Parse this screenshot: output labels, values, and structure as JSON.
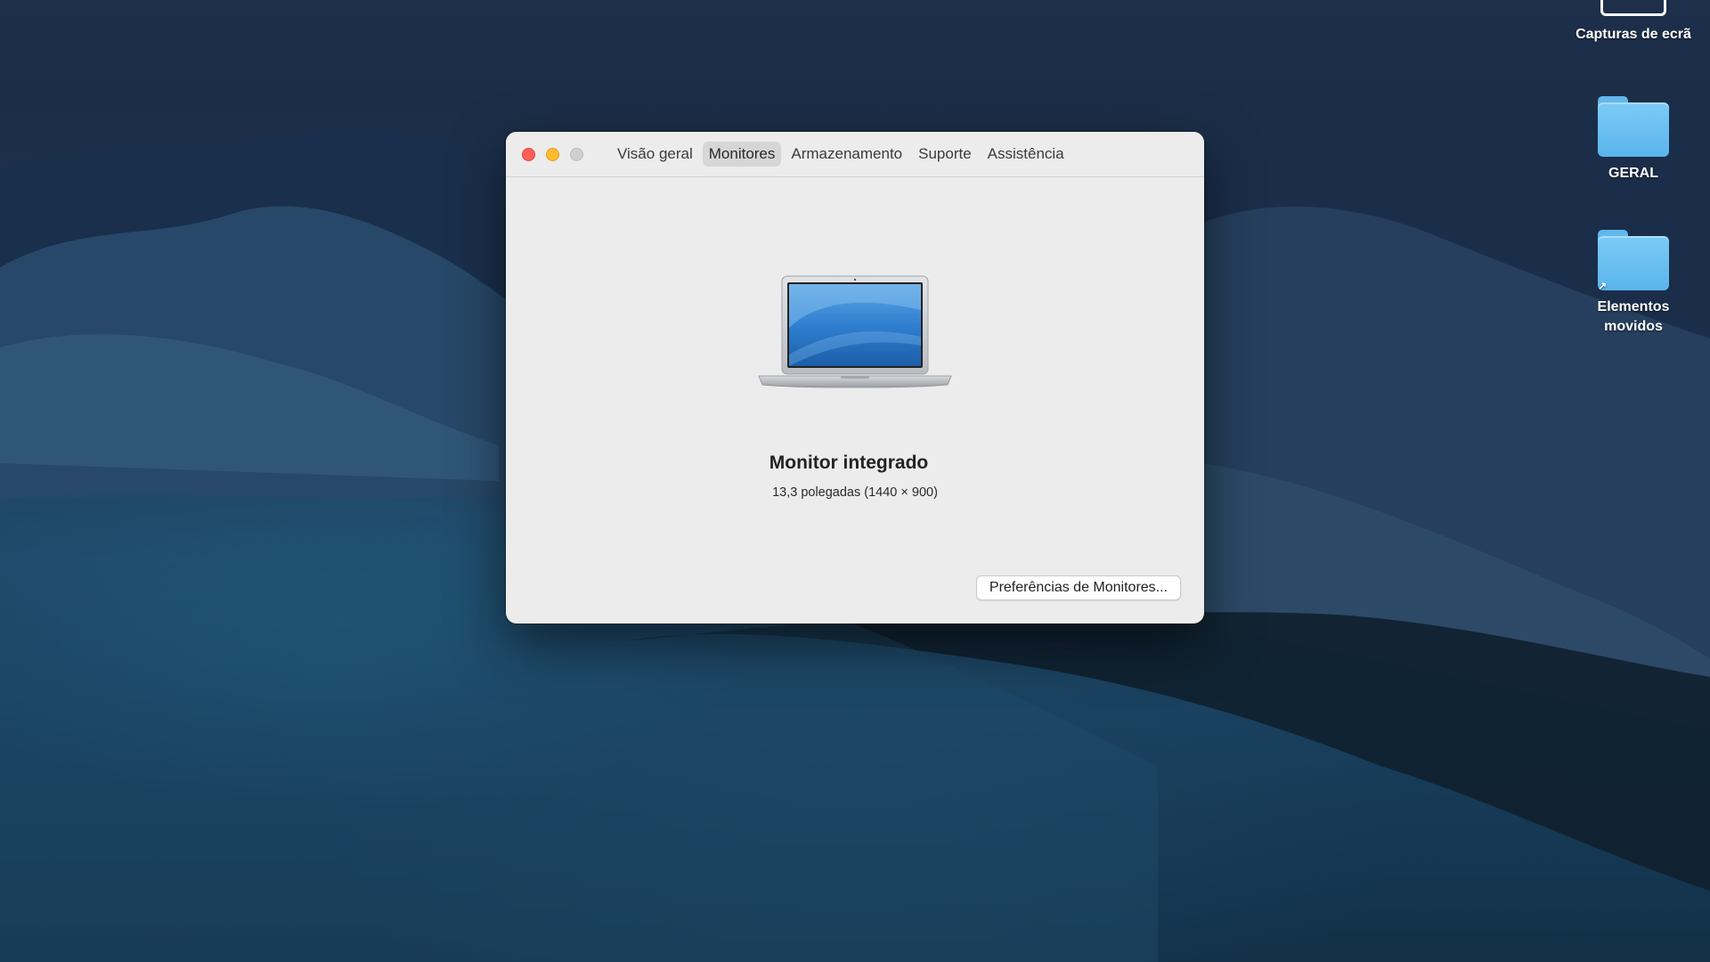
{
  "desktop": {
    "items": [
      {
        "label": "Capturas de ecrã",
        "icon": "screenshots-folder-icon"
      },
      {
        "label": "GERAL",
        "icon": "folder-icon"
      },
      {
        "label": "Elementos\nmovidos",
        "label_line1": "Elementos",
        "label_line2": "movidos",
        "icon": "alias-folder-icon"
      }
    ]
  },
  "window": {
    "tabs": [
      {
        "label": "Visão geral",
        "active": false
      },
      {
        "label": "Monitores",
        "active": true
      },
      {
        "label": "Armazenamento",
        "active": false
      },
      {
        "label": "Suporte",
        "active": false
      },
      {
        "label": "Assistência",
        "active": false
      }
    ],
    "monitor": {
      "title": "Monitor integrado",
      "subtitle": "13,3 polegadas (1440 × 900)",
      "icon": "macbook-laptop-icon"
    },
    "preferences_button": "Preferências de Monitores..."
  },
  "colors": {
    "close": "#fe5f57",
    "minimize": "#febc2e",
    "zoom": "#cfcfcf",
    "folder": "#6ac0f2"
  }
}
